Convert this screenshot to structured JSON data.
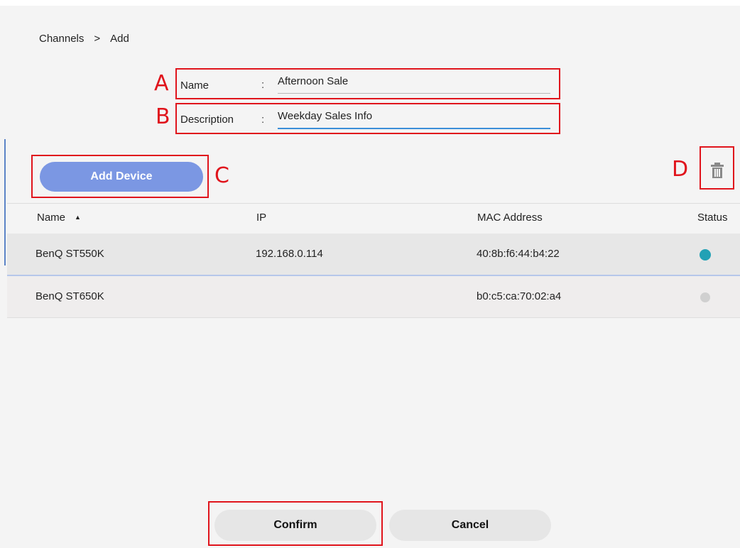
{
  "breadcrumb": {
    "root": "Channels",
    "separator": ">",
    "current": "Add"
  },
  "form": {
    "name_label": "Name",
    "name_value": "Afternoon Sale",
    "description_label": "Description",
    "description_value": "Weekday Sales Info",
    "colon": ":"
  },
  "toolbar": {
    "add_device_label": "Add Device",
    "delete_icon": "trash-icon"
  },
  "annotations": {
    "a": "A",
    "b": "B",
    "c": "C",
    "d": "D"
  },
  "table": {
    "columns": {
      "name": "Name",
      "sort_indicator": "▲",
      "ip": "IP",
      "mac": "MAC Address",
      "status": "Status"
    },
    "rows": [
      {
        "name": "BenQ ST550K",
        "ip": "192.168.0.114",
        "mac": "40:8b:f6:44:b4:22",
        "status_color": "#22a1b5"
      },
      {
        "name": "BenQ ST650K",
        "ip": "",
        "mac": "b0:c5:ca:70:02:a4",
        "status_color": "#d0d0d0"
      }
    ]
  },
  "footer": {
    "confirm_label": "Confirm",
    "cancel_label": "Cancel"
  },
  "colors": {
    "accent": "#7b97e3",
    "highlight": "#e0141c",
    "focus_underline": "#3b8ed8"
  }
}
